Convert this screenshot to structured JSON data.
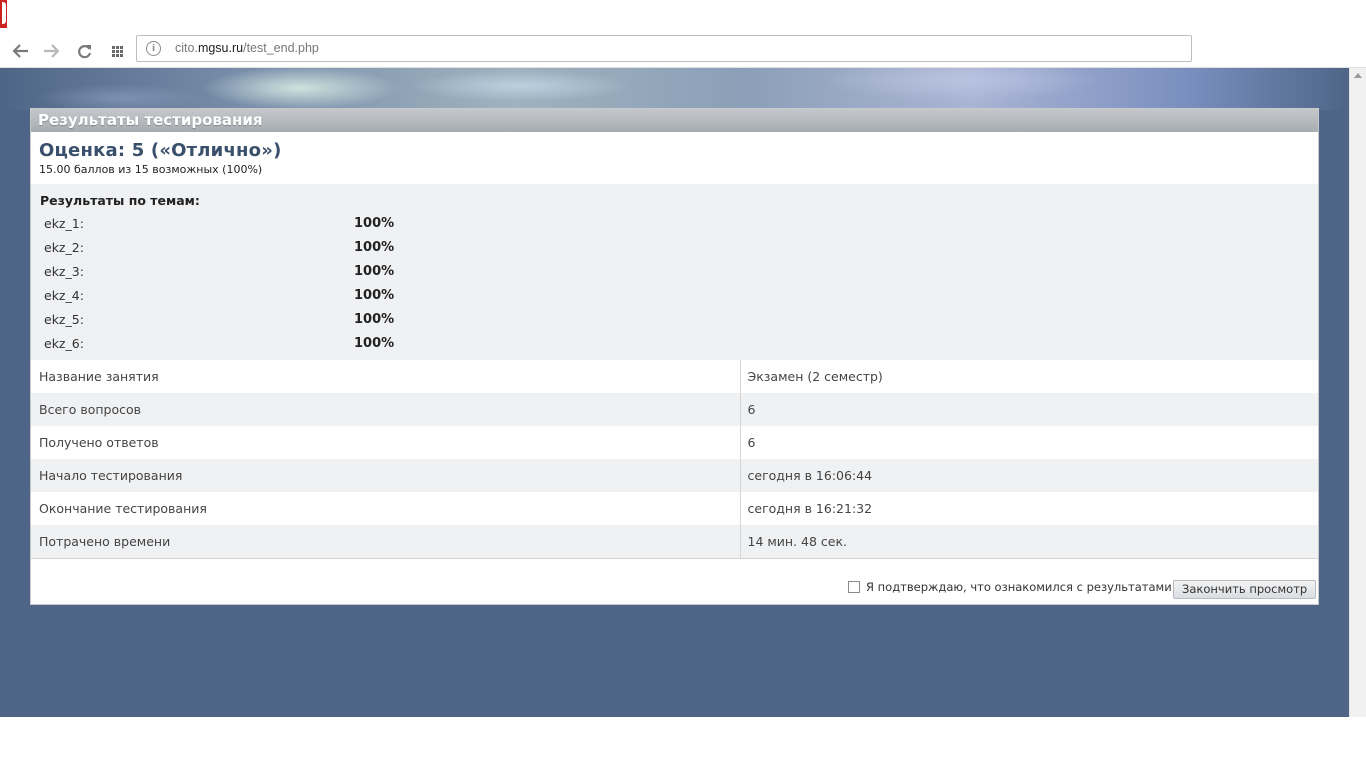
{
  "browser": {
    "url_prefix": "cito.",
    "url_host": "mgsu.ru",
    "url_path": "/test_end.php"
  },
  "panel": {
    "title": "Результаты тестирования",
    "grade": "Оценка: 5 («Отлично»)",
    "score": "15.00 баллов из 15 возможных (100%)",
    "topics_title": "Результаты по темам:",
    "topics": [
      {
        "name": "ekz_1:",
        "value": "100%"
      },
      {
        "name": "ekz_2:",
        "value": "100%"
      },
      {
        "name": "ekz_3:",
        "value": "100%"
      },
      {
        "name": "ekz_4:",
        "value": "100%"
      },
      {
        "name": "ekz_5:",
        "value": "100%"
      },
      {
        "name": "ekz_6:",
        "value": "100%"
      }
    ],
    "info": [
      {
        "label": "Название занятия",
        "value": "Экзамен (2 семестр)"
      },
      {
        "label": "Всего вопросов",
        "value": "6"
      },
      {
        "label": "Получено ответов",
        "value": "6"
      },
      {
        "label": "Начало тестирования",
        "value": "сегодня в 16:06:44"
      },
      {
        "label": "Окончание тестирования",
        "value": "сегодня в 16:21:32"
      },
      {
        "label": "Потрачено времени",
        "value": "14 мин. 48 сек."
      }
    ],
    "confirm_label": "Я подтверждаю, что ознакомился с результатами",
    "finish_button": "Закончить просмотр"
  },
  "icons": {
    "back": "arrow-left-icon",
    "forward": "arrow-right-icon",
    "reload": "reload-icon",
    "apps": "apps-grid-icon",
    "site_info": "site-info-icon"
  }
}
